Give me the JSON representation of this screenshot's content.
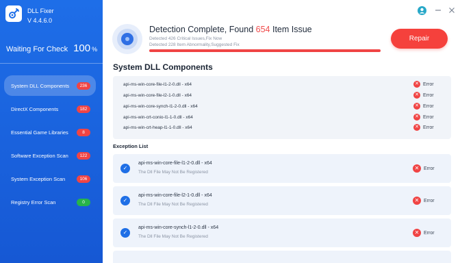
{
  "app": {
    "name": "DLL Fixer",
    "version": "V 4.4.6.0"
  },
  "sidebar": {
    "status_label": "Waiting For Check",
    "status_value": "100",
    "status_unit": "%",
    "items": [
      {
        "label": "System DLL Components",
        "count": "236",
        "badge_color": "#f04444",
        "active": true
      },
      {
        "label": "DirectX Components",
        "count": "182",
        "badge_color": "#f04444",
        "active": false
      },
      {
        "label": "Essential Game Libraries",
        "count": "8",
        "badge_color": "#f04444",
        "active": false
      },
      {
        "label": "Software Exception Scan",
        "count": "122",
        "badge_color": "#f04444",
        "active": false
      },
      {
        "label": "System Exception Scan",
        "count": "106",
        "badge_color": "#f04444",
        "active": false
      },
      {
        "label": "Registry Error Scan",
        "count": "0",
        "badge_color": "#27b34a",
        "active": false
      }
    ]
  },
  "header": {
    "title_prefix": "Detection Complete, Found ",
    "title_count": "654",
    "title_suffix": " Item Issue",
    "sub1": "Detected 426 Critical Issues,Fix Now",
    "sub2": "Detected 228 Item Abnormality,Suggested Fix",
    "repair_label": "Repair"
  },
  "dll_section": {
    "title": "System DLL Components",
    "rows": [
      {
        "name": "api-ms-win-core-file-l1-2-0.dll - x64",
        "status": "Error"
      },
      {
        "name": "api-ms-win-core-file-l2-1-0.dll - x64",
        "status": "Error"
      },
      {
        "name": "api-ms-win-core-synch-l1-2-0.dll - x64",
        "status": "Error"
      },
      {
        "name": "api-ms-win-crt-conio-l1-1-0.dll - x64",
        "status": "Error"
      },
      {
        "name": "api-ms-win-crt-heap-l1-1-0.dll - x64",
        "status": "Error"
      }
    ]
  },
  "exception_section": {
    "title": "Exception List",
    "items": [
      {
        "name": "api-ms-win-core-file-l1-2-0.dll - x64",
        "desc": "The Dll File May Not Be Registered",
        "status": "Error"
      },
      {
        "name": "api-ms-win-core-file-l2-1-0.dll - x64",
        "desc": "The Dll File May Not Be Registered",
        "status": "Error"
      },
      {
        "name": "api-ms-win-core-synch-l1-2-0.dll - x64",
        "desc": "The Dll File May Not Be Registered",
        "status": "Error"
      }
    ]
  },
  "icons": {
    "logo": "wrench-gear-icon",
    "user": "user-avatar-icon",
    "minimize": "minimize-icon",
    "close": "close-icon",
    "error": "error-x-icon",
    "check": "checkmark-icon"
  },
  "colors": {
    "sidebar": "#1e6ee8",
    "accent_red": "#f04444",
    "accent_blue": "#1f6fe6",
    "ok_green": "#27b34a"
  }
}
